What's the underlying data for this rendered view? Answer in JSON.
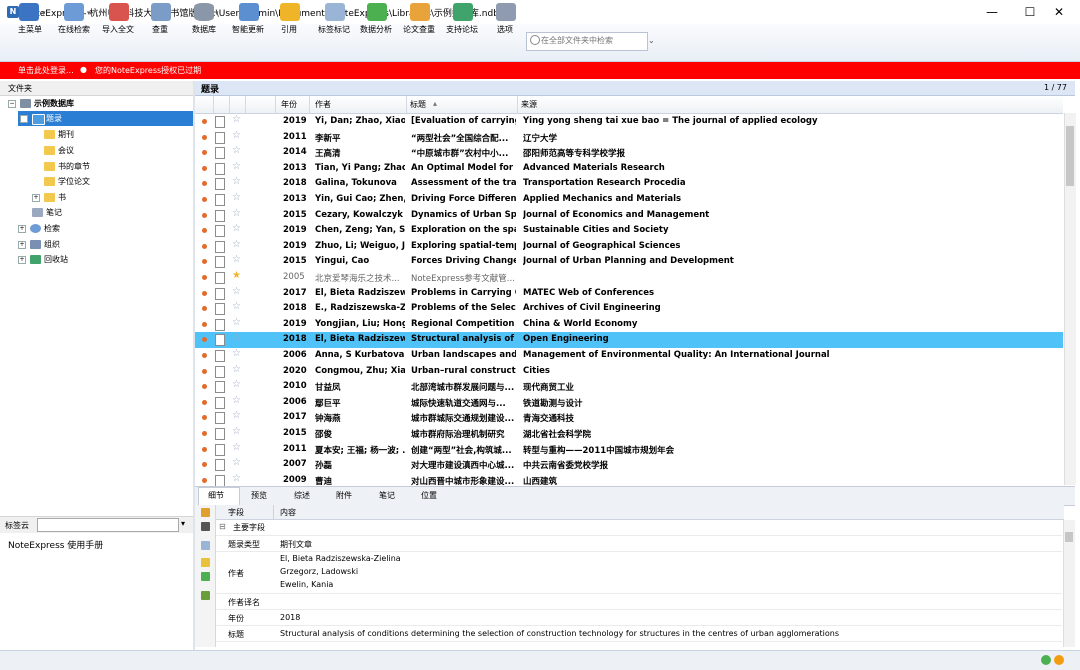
{
  "window": {
    "title": "NoteExpress - 杭州电子科技大学图书馆版 - C:\\Users\\admin\\Documents\\NoteExpress\\Libraries\\示例数据库.ndb"
  },
  "toolbar": {
    "items": [
      "主菜单",
      "在线检索",
      "导入全文",
      "查重",
      "数据库",
      "智能更新",
      "引用",
      "标签标记",
      "数据分析",
      "论文查重",
      "支持论坛",
      "选项"
    ],
    "search_placeholder": "在全部文件夹中检索"
  },
  "banner": {
    "login": "单击此处登录...",
    "license": "您的NoteExpress授权已过期"
  },
  "left": {
    "header": "文件夹",
    "tree": [
      {
        "label": "示例数据库",
        "level": 0
      },
      {
        "label": "题录",
        "level": 1,
        "selected": true
      },
      {
        "label": "期刊",
        "level": 2
      },
      {
        "label": "会议",
        "level": 2
      },
      {
        "label": "书的章节",
        "level": 2
      },
      {
        "label": "学位论文",
        "level": 2
      },
      {
        "label": "书",
        "level": 2
      },
      {
        "label": "笔记",
        "level": 1
      },
      {
        "label": "检索",
        "level": 1
      },
      {
        "label": "组织",
        "level": 1
      },
      {
        "label": "回收站",
        "level": 1
      }
    ],
    "tag_label": "标签云",
    "manual": "NoteExpress  使用手册"
  },
  "list": {
    "header": "题录",
    "page": "1 / 77",
    "columns": [
      "年份",
      "作者",
      "标题",
      "来源"
    ],
    "rows": [
      {
        "year": "2019",
        "author": "Yi, Dan; Zhao, Xiao-...",
        "title": "[Evaluation of carrying c",
        "source": "Ying yong sheng tai xue bao = The journal of applied ecology"
      },
      {
        "year": "2011",
        "author": "李新平",
        "title": "“两型社会”全国综合配...",
        "source": "辽宁大学"
      },
      {
        "year": "2014",
        "author": "王高清",
        "title": "“中原城市群”农村中小...",
        "source": "邵阳师范高等专科学校学报"
      },
      {
        "year": "2013",
        "author": "Tian, Yi Pang; Zhao,",
        "title": "An Optimal Model for C",
        "source": "Advanced Materials Research"
      },
      {
        "year": "2018",
        "author": "Galina, Tokunova",
        "title": "Assessment of the trans.",
        "source": "Transportation Research Procedia"
      },
      {
        "year": "2013",
        "author": "Yin, Gui Cao; Zhen, ..",
        "title": "Driving Force Difference",
        "source": "Applied Mechanics and Materials"
      },
      {
        "year": "2015",
        "author": "Cezary, Kowalczyk",
        "title": "Dynamics of Urban Spa.",
        "source": "Journal of Economics and Management"
      },
      {
        "year": "2019",
        "author": "Chen, Zeng; Yan, So.",
        "title": "Exploration on the spati",
        "source": "Sustainable Cities and Society"
      },
      {
        "year": "2019",
        "author": "Zhuo, Li; Weiguo, Jia",
        "title": "Exploring spatial-tempc",
        "source": "Journal of Geographical Sciences"
      },
      {
        "year": "2015",
        "author": "Yingui, Cao",
        "title": "Forces Driving Changes",
        "source": "Journal of Urban Planning and Development"
      },
      {
        "year": "2005",
        "author": "北京爱琴海乐之技术...",
        "title": "NoteExpress参考文献管...",
        "source": "",
        "gray": true
      },
      {
        "year": "2017",
        "author": "El, Bieta Radziszewsk",
        "title": "Problems in Carrying O.",
        "source": "MATEC Web of Conferences"
      },
      {
        "year": "2018",
        "author": "E., Radziszewska-Zie",
        "title": "Problems of the Selectic",
        "source": "Archives of Civil Engineering"
      },
      {
        "year": "2019",
        "author": "Yongjian, Liu; Hong,",
        "title": "Regional Competition ir",
        "source": "China & World Economy"
      },
      {
        "year": "2018",
        "author": "El, Bieta Radziszewsk",
        "title": "Structural analysis of co",
        "source": "Open Engineering",
        "selected": true
      },
      {
        "year": "2006",
        "author": "Anna, S Kurbatova; .",
        "title": "Urban landscapes and s.",
        "source": "Management of Environmental Quality: An International Journal"
      },
      {
        "year": "2020",
        "author": "Congmou, Zhu; Xiao",
        "title": "Urban–rural constructio",
        "source": "Cities"
      },
      {
        "year": "2010",
        "author": "甘益凤",
        "title": "北部湾城市群发展问题与...",
        "source": "现代商贸工业"
      },
      {
        "year": "2006",
        "author": "鄢巨平",
        "title": "城际快速轨道交通网与...",
        "source": "铁道勘测与设计"
      },
      {
        "year": "2017",
        "author": "钟海燕",
        "title": "城市群城际交通规划建设...",
        "source": "青海交通科技"
      },
      {
        "year": "2015",
        "author": "邵俊",
        "title": "城市群府际治理机制研究",
        "source": "湖北省社会科学院"
      },
      {
        "year": "2011",
        "author": "夏本安; 王福; 杨一波; ..",
        "title": "创建“两型”社会,构筑城...",
        "source": "转型与重构——2011中国城市规划年会"
      },
      {
        "year": "2007",
        "author": "孙磊",
        "title": "对大理市建设滇西中心城...",
        "source": "中共云南省委党校学报"
      },
      {
        "year": "2009",
        "author": "曹迪",
        "title": "对山西晋中城市形象建设...",
        "source": "山西建筑"
      }
    ]
  },
  "detail": {
    "tabs": [
      "细节",
      "预览",
      "综述",
      "附件",
      "笔记",
      "位置"
    ],
    "col_field": "字段",
    "col_content": "内容",
    "section": "主要字段",
    "fields": [
      {
        "label": "题录类型",
        "value": "期刊文章"
      },
      {
        "label": "作者",
        "values": [
          "El, Bieta Radziszewska-Zielina",
          "Grzegorz, Ladowski",
          "Ewelin, Kania"
        ]
      },
      {
        "label": "作者译名",
        "value": ""
      },
      {
        "label": "年份",
        "value": "2018"
      },
      {
        "label": "标题",
        "value": "Structural analysis of conditions determining the selection of construction technology for structures in the centres of urban agglomerations"
      }
    ]
  },
  "colors": {
    "banner": "#ff0000",
    "selected_row": "#4fc3f7",
    "tree_selected": "#2a7fd4"
  }
}
